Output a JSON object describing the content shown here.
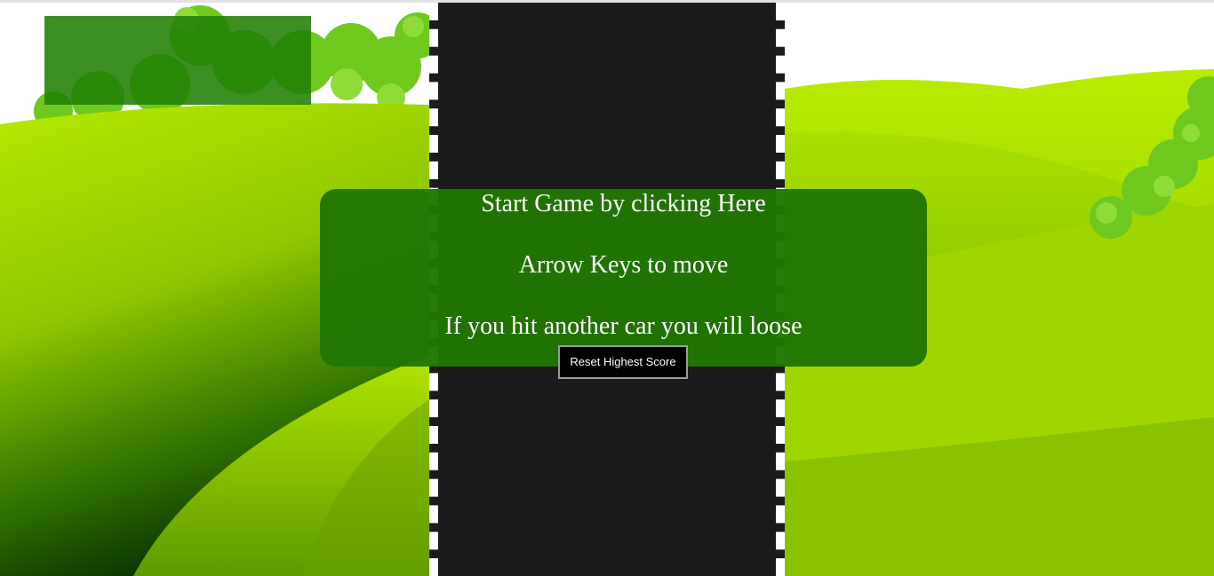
{
  "game": {
    "score_panel": {
      "text": ""
    },
    "instructions": {
      "start": "Start Game by clicking Here",
      "controls": "Arrow Keys to move",
      "rule": "If you hit another car you will loose"
    },
    "reset_button_label": "Reset Highest Score"
  },
  "colors": {
    "road": "#1c1b1b",
    "road_edge_dash": "#ffffff",
    "overlay": "#217603",
    "score_panel": "#228006",
    "grass_light": "#b3e800",
    "grass_dark": "#0f3a00",
    "bush": "#6cc61a"
  }
}
